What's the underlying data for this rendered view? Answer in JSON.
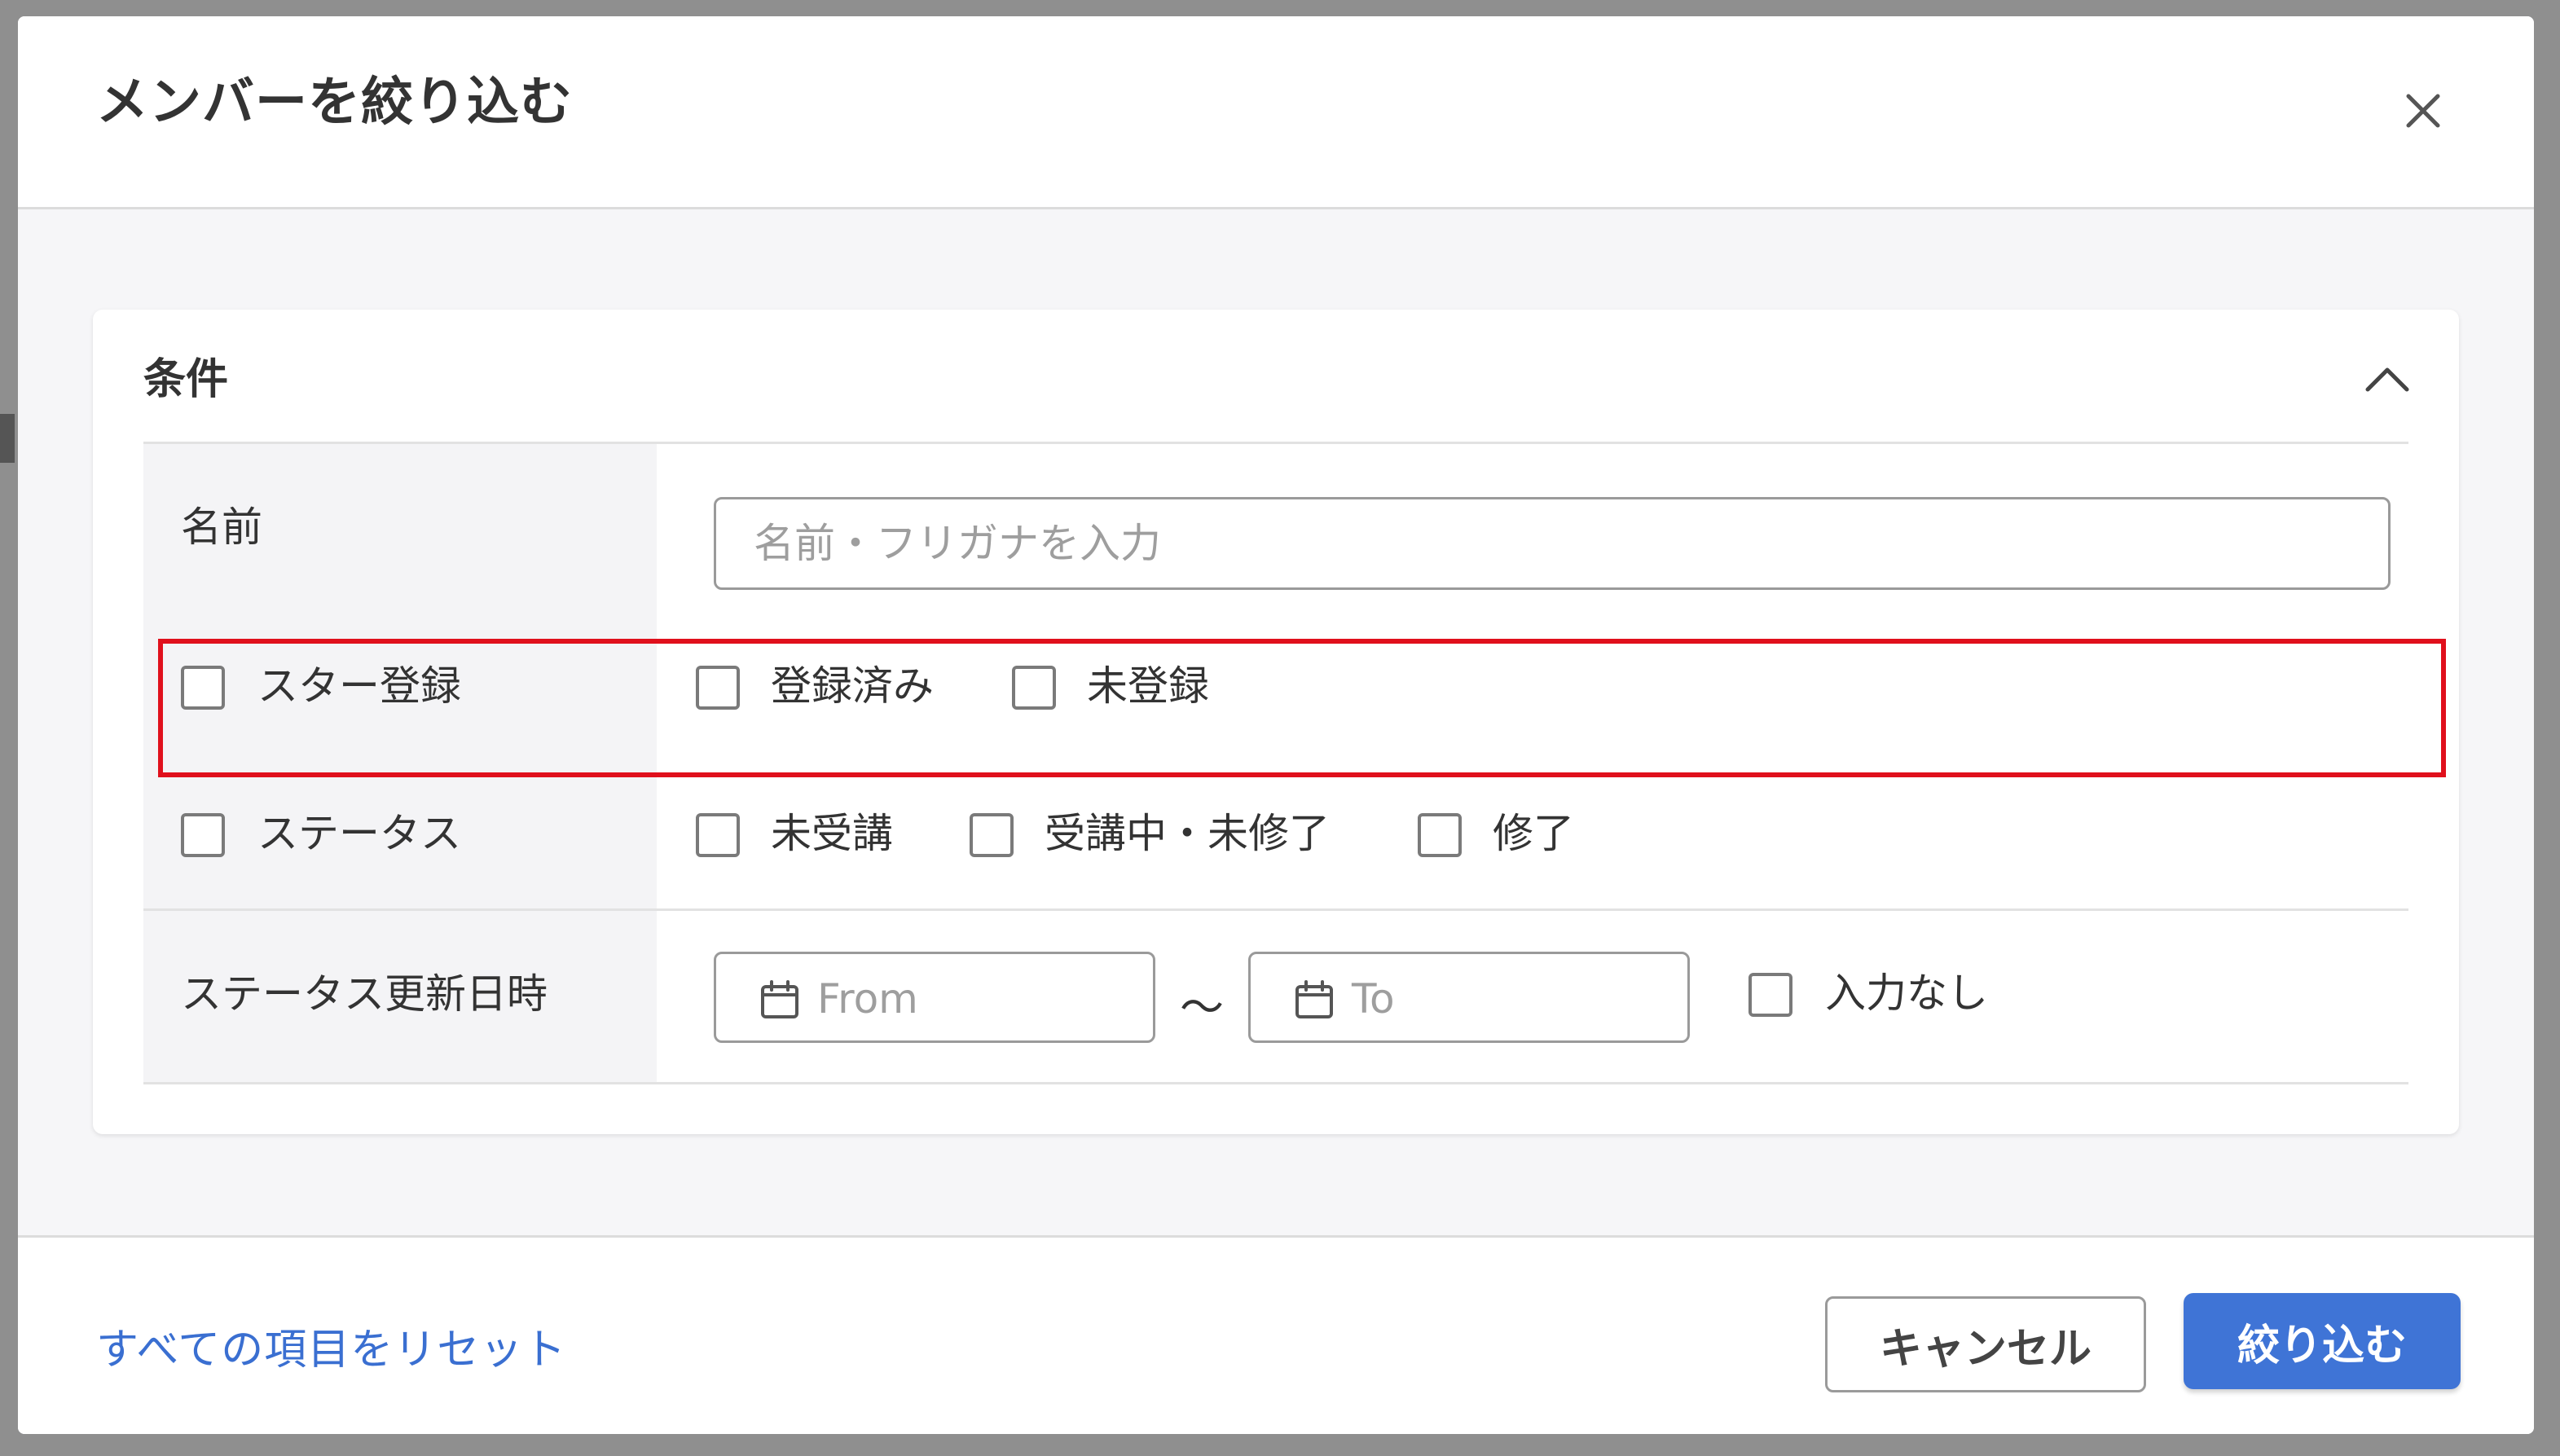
{
  "modal": {
    "title": "メンバーを絞り込む"
  },
  "conditions": {
    "title": "条件",
    "name": {
      "label": "名前",
      "placeholder": "名前・フリガナを入力"
    },
    "star": {
      "label": "スター登録",
      "options": [
        "登録済み",
        "未登録"
      ]
    },
    "status": {
      "label": "ステータス",
      "options": [
        "未受講",
        "受講中・未修了",
        "修了"
      ]
    },
    "status_updated": {
      "label": "ステータス更新日時",
      "from_placeholder": "From",
      "separator": "〜",
      "to_placeholder": "To",
      "no_input_label": "入力なし"
    }
  },
  "footer": {
    "reset_label": "すべての項目をリセット",
    "cancel_label": "キャンセル",
    "apply_label": "絞り込む"
  },
  "colors": {
    "accent": "#3f74d6",
    "link": "#3a6fd1",
    "highlight": "#e0101c"
  },
  "icons": {
    "close": "close-icon",
    "collapse": "chevron-up-icon",
    "calendar": "calendar-icon"
  }
}
